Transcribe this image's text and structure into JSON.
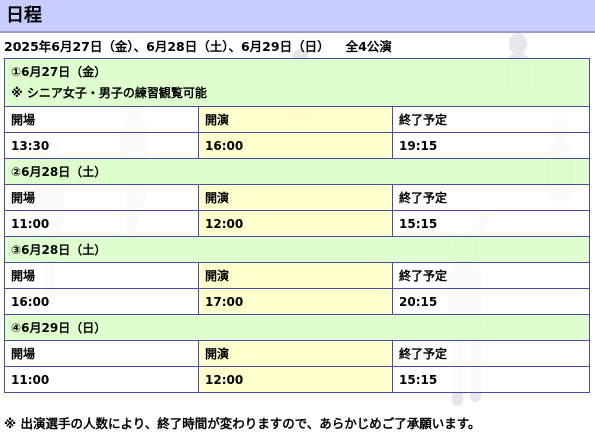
{
  "page": {
    "title": "日程",
    "summary": "2025年6月27日（金）、6月28日（土）、6月29日（日）",
    "performance_count": "全4公演",
    "footnote": "※ 出演選手の人数により、終了時間が変わりますので、あらかじめご了承願います。"
  },
  "performances": [
    {
      "date": "①6月27日（金）",
      "note": "※ シニア女子・男子の練習観覧可能",
      "headers": [
        "開場",
        "開演",
        "終了予定"
      ],
      "times": [
        "13:30",
        "16:00",
        "19:15"
      ]
    },
    {
      "date": "②6月28日（土）",
      "headers": [
        "開場",
        "開演",
        "終了予定"
      ],
      "times": [
        "11:00",
        "12:00",
        "15:15"
      ]
    },
    {
      "date": "③6月28日（土）",
      "headers": [
        "開場",
        "開演",
        "終了予定"
      ],
      "times": [
        "16:00",
        "17:00",
        "20:15"
      ]
    },
    {
      "date": "④6月29日（日）",
      "headers": [
        "開場",
        "開演",
        "終了予定"
      ],
      "times": [
        "11:00",
        "12:00",
        "15:15"
      ]
    }
  ],
  "colors": {
    "heading_bg": "#c8ccff",
    "date_row_bg": "#dcffc8",
    "highlight_col_bg": "#ffffc8",
    "border": "#4a4aa8"
  }
}
